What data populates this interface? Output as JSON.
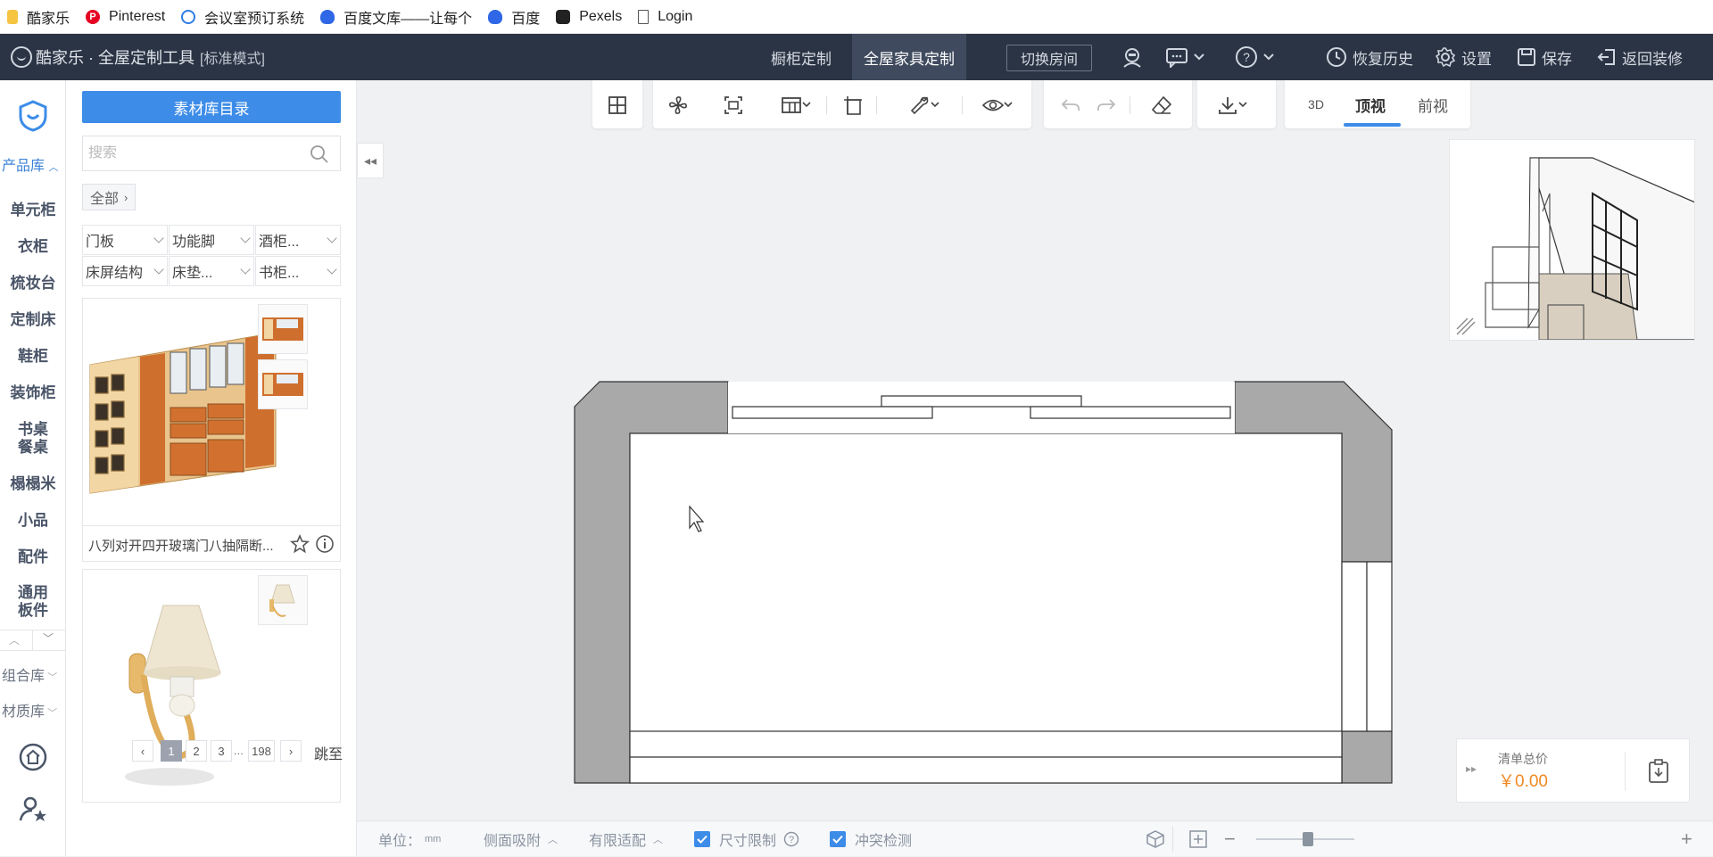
{
  "bookmarks": [
    {
      "label": "酷家乐",
      "icon": "folder-icon"
    },
    {
      "label": "Pinterest",
      "icon": "pinterest-icon"
    },
    {
      "label": "会议室预订系统",
      "icon": "kujiale-icon"
    },
    {
      "label": "百度文库——让每个",
      "icon": "baidu-paw-icon"
    },
    {
      "label": "百度",
      "icon": "baidu-paw-icon"
    },
    {
      "label": "Pexels",
      "icon": "camera-icon"
    },
    {
      "label": "Login",
      "icon": "page-icon"
    }
  ],
  "header": {
    "app_title": "酷家乐 · 全屋定制工具",
    "mode": "[标准模式]",
    "tabs": [
      "橱柜定制",
      "全屋家具定制"
    ],
    "active_tab": "全屋家具定制",
    "switch_room": "切换房间",
    "restore_history": "恢复历史",
    "settings": "设置",
    "save": "保存",
    "back": "返回装修"
  },
  "leftnav": {
    "product_lib": "产品库",
    "items": [
      "单元柜",
      "衣柜",
      "梳妆台",
      "定制床",
      "鞋柜",
      "装饰柜",
      "书桌\n餐桌",
      "榻榻米",
      "小品",
      "配件",
      "通用\n板件"
    ],
    "combo_lib": "组合库",
    "material_lib": "材质库"
  },
  "panel": {
    "catalog_button": "素材库目录",
    "search_placeholder": "搜索",
    "breadcrumb": "全部",
    "filters": [
      "门板",
      "功能脚",
      "酒柜...",
      "床屏结构",
      "床垫...",
      "书柜..."
    ],
    "products": [
      {
        "name": "八列对开四开玻璃门八抽隔断..."
      },
      {
        "name": ""
      }
    ],
    "pagination": {
      "pages": [
        "1",
        "2",
        "3",
        "...",
        "198"
      ],
      "current": "1",
      "jump": "跳至"
    }
  },
  "toolbar": {
    "views": [
      "3D",
      "顶视",
      "前视"
    ],
    "active_view": "顶视"
  },
  "bottombar": {
    "unit_label": "单位：",
    "unit_value": "mm",
    "side_snap": "侧面吸附",
    "limited_fit": "有限适配",
    "size_limit": "尺寸限制",
    "collision": "冲突检测"
  },
  "price": {
    "label": "清单总价",
    "value": "￥0.00"
  },
  "colors": {
    "header_bg": "#2b3444",
    "accent": "#3d8ce8",
    "price": "#f08a24",
    "wall": "#a9a9a9"
  }
}
